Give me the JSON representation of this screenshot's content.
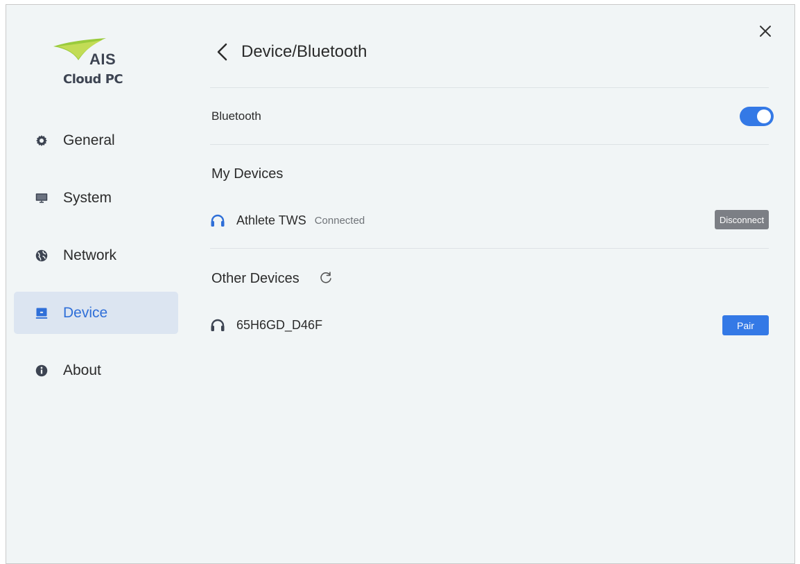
{
  "app": {
    "logo_brand": "AIS",
    "logo_product": "Cloud PC"
  },
  "sidebar": {
    "items": [
      {
        "label": "General",
        "icon": "gear-icon"
      },
      {
        "label": "System",
        "icon": "monitor-icon"
      },
      {
        "label": "Network",
        "icon": "globe-icon"
      },
      {
        "label": "Device",
        "icon": "device-icon",
        "active": true
      },
      {
        "label": "About",
        "icon": "info-icon"
      }
    ]
  },
  "header": {
    "title": "Device/Bluetooth"
  },
  "bluetooth": {
    "label": "Bluetooth",
    "enabled": true
  },
  "my_devices": {
    "title": "My Devices",
    "devices": [
      {
        "name": "Athlete TWS",
        "status": "Connected",
        "action": "Disconnect"
      }
    ]
  },
  "other_devices": {
    "title": "Other Devices",
    "devices": [
      {
        "name": "65H6GD_D46F",
        "action": "Pair"
      }
    ]
  },
  "colors": {
    "accent": "#3479e6",
    "active_nav_bg": "#dce5f1",
    "background": "#f1f5f6",
    "disconnect_button": "#7c7f85"
  }
}
